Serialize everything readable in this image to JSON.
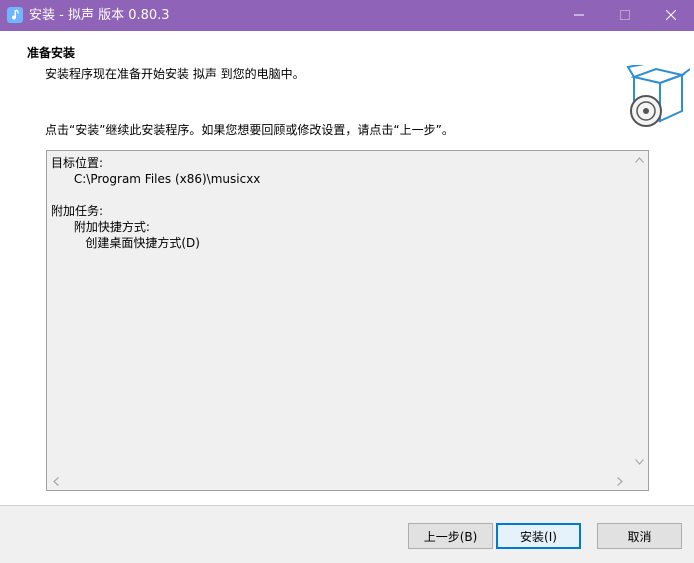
{
  "window": {
    "title": "安装 - 拟声 版本 0.80.3",
    "icons": {
      "app": "music-note-icon",
      "minimize": "minimize-icon",
      "maximize": "maximize-icon",
      "close": "close-icon"
    }
  },
  "header": {
    "heading": "准备安装",
    "subheading": "安装程序现在准备开始安装 拟声 到您的电脑中。",
    "icon": "install-box-cd-icon"
  },
  "instruction": "点击“安装”继续此安装程序。如果您想要回顾或修改设置，请点击“上一步”。",
  "memo": {
    "lines": [
      "目标位置:",
      "      C:\\Program Files (x86)\\musicxx",
      "",
      "附加任务:",
      "      附加快捷方式:",
      "         创建桌面快捷方式(D)"
    ]
  },
  "buttons": {
    "back": "上一步(B)",
    "install": "安装(I)",
    "cancel": "取消"
  },
  "colors": {
    "titlebar": "#8e63b8",
    "accent": "#0078d7",
    "memo_bg": "#f0f0f0"
  }
}
